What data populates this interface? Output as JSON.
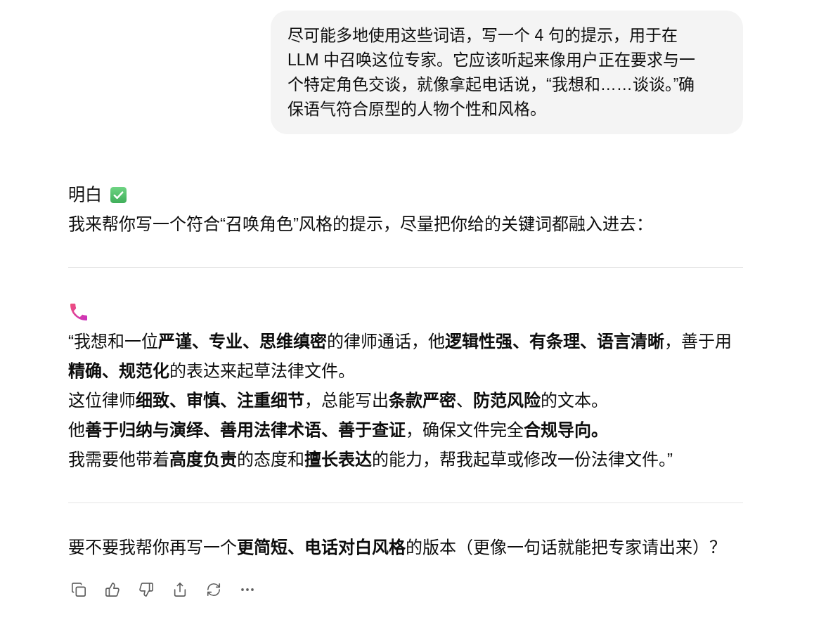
{
  "user_message": {
    "lines": [
      "尽可能多地使用这些词语，写一个 4 句的提示，用于在",
      "LLM 中召唤这位专家。它应该听起来像用户正在要求与一",
      "个特定角色交谈，就像拿起电话说，“我想和……谈谈。”确",
      "保语气符合原型的人物个性和风格。"
    ]
  },
  "assistant_message": {
    "title": "明白",
    "intro": "我来帮你写一个符合“召唤角色”风格的提示，尽量把你给的关键词都融入进去：",
    "prompt_lines": [
      "“我想和一位**严谨、专业、思维缜密**的律师通话，他**逻辑性强、有条理、语言清晰**，善于用**精确、规范化**的表达来起草法律文件。",
      "这位律师**细致、审慎、注重细节**，总能写出**条款严密**、**防范风险**的文本。",
      "他**善于归纳与演绎、善用法律术语、善于查证**，确保文件完全**合规导向。**",
      "我需要他带着**高度负责**的态度和**擅长表达**的能力，帮我起草或修改一份法律文件。”"
    ],
    "follow_up": "要不要我帮你再写一个**更简短、电话对白风格**的版本（更像一句话就能把专家请出来）？"
  }
}
